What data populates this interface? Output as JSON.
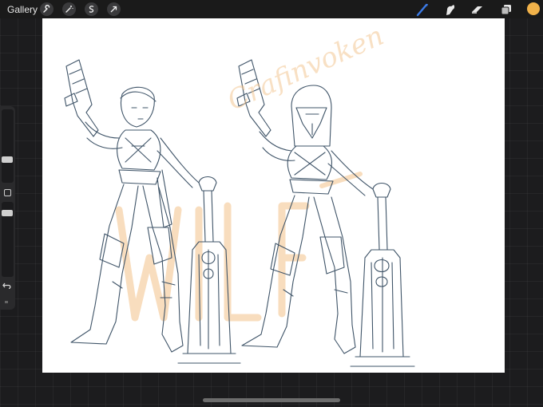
{
  "topbar": {
    "gallery_label": "Gallery",
    "left_tools": [
      {
        "name": "actions-wrench",
        "icon": "wrench-icon"
      },
      {
        "name": "adjustments-wand",
        "icon": "magic-wand-icon"
      },
      {
        "name": "selection",
        "icon": "selection-s-icon"
      },
      {
        "name": "transform",
        "icon": "transform-arrow-icon"
      }
    ],
    "right_tools": [
      {
        "name": "brush",
        "icon": "brush-icon",
        "active": true
      },
      {
        "name": "smudge",
        "icon": "smudge-icon",
        "active": false
      },
      {
        "name": "eraser",
        "icon": "eraser-icon",
        "active": false
      },
      {
        "name": "layers",
        "icon": "layers-icon",
        "active": false
      }
    ],
    "current_color": "#f1b24a",
    "active_tool_color": "#3b7be8"
  },
  "sidebar": {
    "brush_size_slider": 0.8,
    "opacity_slider": 0.55,
    "modify_button_icon": "square-icon",
    "undo_icon": "undo-arrow-icon",
    "redo_icon": "redo-arrow-icon"
  },
  "canvas": {
    "background": "#ffffff",
    "content": "two-armored-characters-pencil-sketch",
    "sketch_color": "#3f5468",
    "watermark_text": "Crafinvoken",
    "watermark_color": "#f4c894"
  }
}
